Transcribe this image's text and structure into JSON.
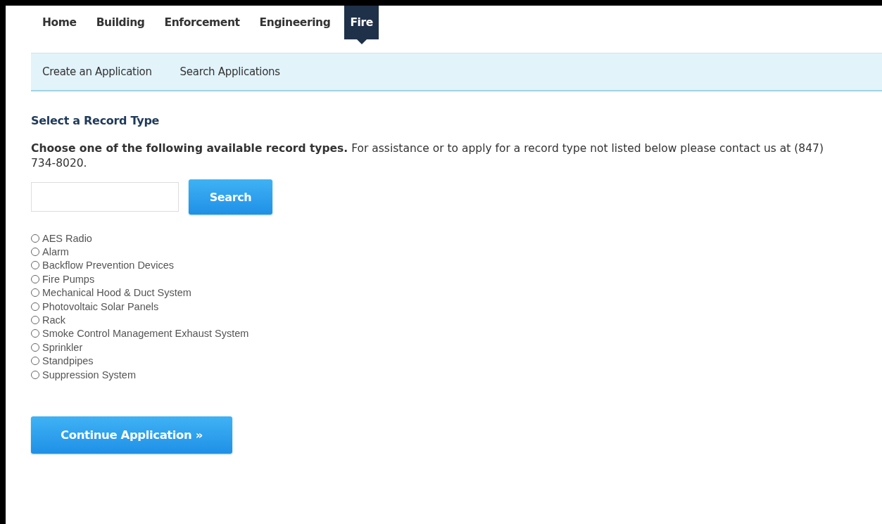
{
  "tabs": [
    {
      "label": "Home",
      "selected": false
    },
    {
      "label": "Building",
      "selected": false
    },
    {
      "label": "Enforcement",
      "selected": false
    },
    {
      "label": "Engineering",
      "selected": false
    },
    {
      "label": "Fire",
      "selected": true
    }
  ],
  "subnav": [
    "Create an Application",
    "Search Applications"
  ],
  "heading": "Select a Record Type",
  "intro": "**Choose one of the following available record types.** For assistance or to apply for a record type not listed below please contact us at (847) 734-8020.",
  "search": {
    "button": "Search"
  },
  "record_types": [
    {
      "label": "AES Radio",
      "selected": false
    },
    {
      "label": "Alarm",
      "selected": false
    },
    {
      "label": "Backflow Prevention Devices",
      "selected": false
    },
    {
      "label": "Fire Pumps",
      "selected": false
    },
    {
      "label": "Mechanical Hood & Duct System",
      "selected": false
    },
    {
      "label": "Photovoltaic Solar Panels",
      "selected": false
    },
    {
      "label": "Rack",
      "selected": false
    },
    {
      "label": "Smoke Control Management Exhaust System",
      "selected": false
    },
    {
      "label": "Sprinkler",
      "selected": false
    },
    {
      "label": "Standpipes",
      "selected": false
    },
    {
      "label": "Suppression System",
      "selected": false
    }
  ],
  "continue_button": "Continue Application »"
}
